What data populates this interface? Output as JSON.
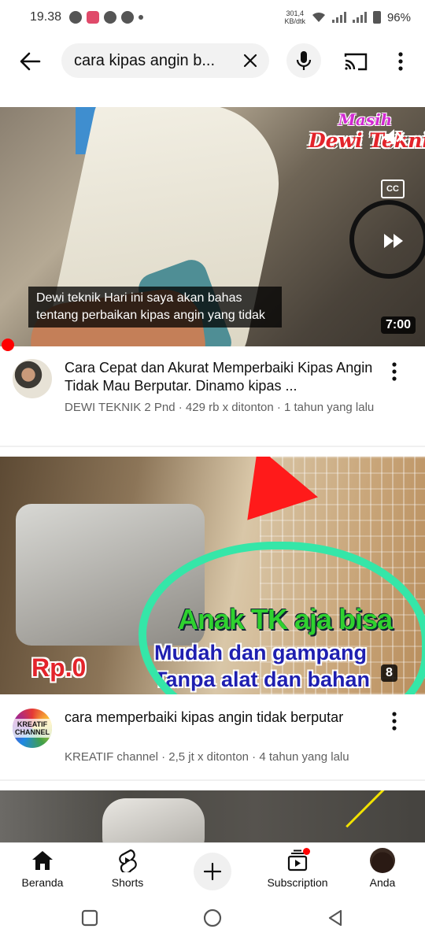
{
  "status_bar": {
    "time": "19.38",
    "net_speed_value": "301,4",
    "net_speed_unit": "KB/dtk",
    "battery": "96%"
  },
  "search": {
    "query": "cara kipas angin b..."
  },
  "videos": [
    {
      "brand_line1": "Masih",
      "brand_line2": "Dewi Teknik",
      "cc_label": "CC",
      "caption": "Dewi teknik Hari ini saya akan bahas tentang perbaikan kipas angin yang tidak",
      "duration": "7:00",
      "title": "Cara Cepat dan Akurat Memperbaiki Kipas Angin Tidak Mau Berputar. Dinamo kipas ...",
      "meta": "DEWI TEKNIK 2 Pnd · 429 rb x ditonton · 1 tahun yang lalu"
    },
    {
      "overlay_line1": "Anak TK aja bisa",
      "overlay_line2": "Mudah dan gampang",
      "overlay_line3": "Tanpa alat dan bahan",
      "price": "Rp.0",
      "duration": "8",
      "avatar_text": "KREATIF CHANNEL",
      "title": "cara memperbaiki kipas angin tidak berputar",
      "meta": "KREATIF channel · 2,5 jt x ditonton · 4 tahun yang lalu"
    }
  ],
  "bottom_nav": {
    "home": "Beranda",
    "shorts": "Shorts",
    "subscriptions": "Subscription",
    "you": "Anda"
  },
  "colors": {
    "accent_red": "#ff0000",
    "annotation_green": "#35e6a8"
  }
}
